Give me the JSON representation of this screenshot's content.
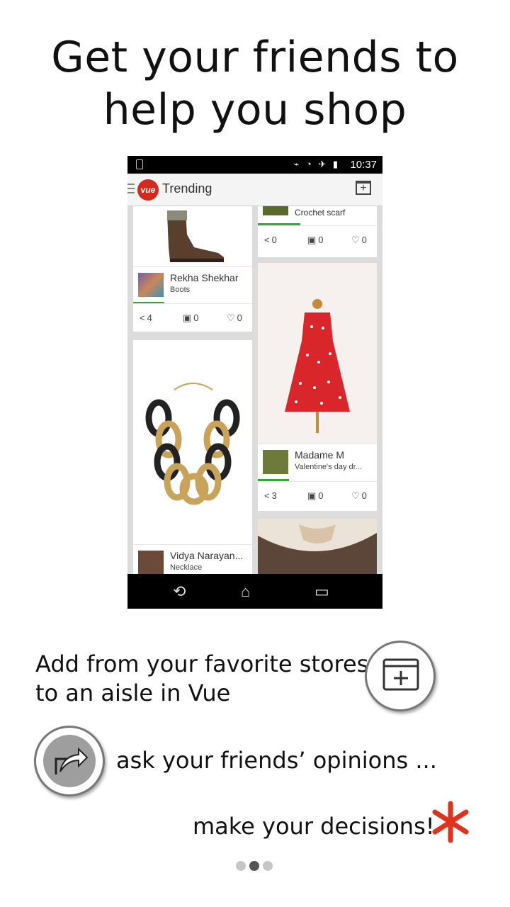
{
  "headline": "Get your friends to help you shop",
  "status_bar": {
    "time": "10:37"
  },
  "app_bar": {
    "logo_text": "vue",
    "title": "Trending"
  },
  "feed": {
    "cards": [
      {
        "title": "Crochet scarf",
        "shares": "0",
        "saves": "0",
        "likes": "0"
      },
      {
        "user": "Rekha Shekhar",
        "tag": "Boots",
        "shares": "4",
        "saves": "0",
        "likes": "0"
      },
      {
        "user": "Madame M",
        "tag": "Valentine's day dr...",
        "shares": "3",
        "saves": "0",
        "likes": "0"
      },
      {
        "user": "Vidya Narayan...",
        "tag": "Necklace"
      }
    ]
  },
  "promo": {
    "line1": "Add from your favorite stores",
    "line2": "to an aisle in Vue",
    "ask": "ask your friends’ opinions ...",
    "decide": "make your decisions!"
  },
  "pager": {
    "pages": 3,
    "current": 2
  },
  "colors": {
    "brand_red": "#d42a1e",
    "progress_green": "#39a33c",
    "asterisk": "#e0321c"
  }
}
